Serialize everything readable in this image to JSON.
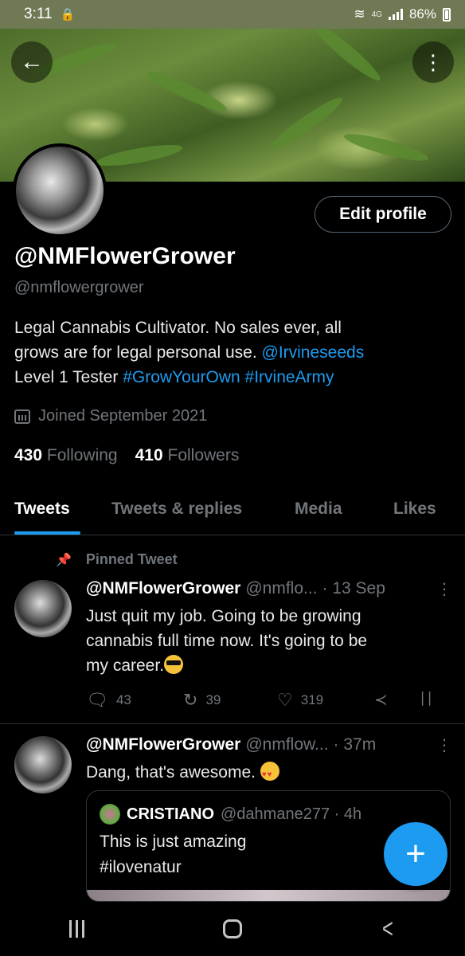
{
  "status_bar": {
    "time": "3:11",
    "network": "4G",
    "battery": "86%"
  },
  "profile": {
    "display_name": "@NMFlowerGrower",
    "handle": "@nmflowergrower",
    "bio_line1": "Legal Cannabis Cultivator. No sales ever,  all",
    "bio_line2_text": "grows are for legal personal use. ",
    "bio_line2_link": "@Irvineseeds",
    "bio_line3_text": "Level 1 Tester ",
    "bio_line3_tag1": "#GrowYourOwn",
    "bio_line3_tag2": "#IrvineArmy",
    "joined": "Joined September 2021",
    "following_count": "430",
    "following_label": "Following",
    "followers_count": "410",
    "followers_label": "Followers",
    "edit_label": "Edit profile"
  },
  "tabs": [
    "Tweets",
    "Tweets & replies",
    "Media",
    "Likes"
  ],
  "pinned_label": "Pinned Tweet",
  "tweets": [
    {
      "name": "@NMFlowerGrower",
      "handle": "@nmflo...",
      "time": "· 13 Sep",
      "line1": "Just quit my job.  Going to be growing",
      "line2": "cannabis full time now.  It's going to be",
      "line3": "my career.",
      "replies": "43",
      "retweets": "39",
      "likes": "319"
    },
    {
      "name": "@NMFlowerGrower",
      "handle": "@nmflow...",
      "time": "· 37m",
      "text": "Dang, that's awesome. ",
      "quote": {
        "name": "CRISTIANO",
        "handle": "@dahmane277 · 4h",
        "line1": "This is just amazing",
        "line2": "#ilovenatur"
      }
    }
  ],
  "icons": {
    "back": "back-arrow-icon",
    "more": "more-vertical-icon",
    "pin": "pin-icon",
    "reply": "reply-icon",
    "retweet": "retweet-icon",
    "like": "heart-icon",
    "share": "share-icon",
    "analytics": "analytics-icon",
    "compose": "compose-plus-icon"
  },
  "colors": {
    "accent": "#1d9bf0",
    "muted": "#71767b",
    "background": "#000000",
    "status_bar": "#6f7a55"
  }
}
